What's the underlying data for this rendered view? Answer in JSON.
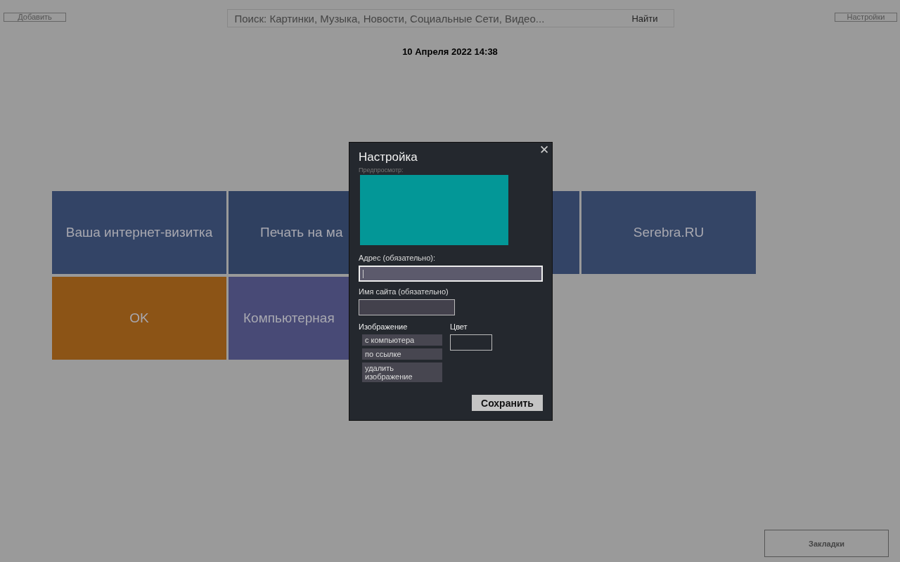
{
  "top_bar": {
    "add_button": "Добавить",
    "search": {
      "placeholder": "Поиск: Картинки, Музыка, Новости, Социальные Сети, Видео...",
      "button": "Найти"
    },
    "settings_button": "Настройки"
  },
  "datetime": "10 Апреля 2022 14:38",
  "tiles": [
    {
      "label": "Ваша интернет-визитка",
      "color": "#334466"
    },
    {
      "label": "Печать на ма",
      "color": "#2f4060"
    },
    {
      "color": "#334466"
    },
    {
      "label": "Serebra.RU",
      "color": "#344566"
    },
    {
      "label": "OK",
      "color": "#8c5416"
    },
    {
      "label": "Компьютерная",
      "color": "#484a76"
    }
  ],
  "dialog": {
    "title": "Настройка",
    "close": "✕",
    "preview_label": "Предпросмотр:",
    "address_label": "Адрес (обязательно):",
    "name_label": "Имя сайта (обязательно)",
    "image_label": "Изображение",
    "image_buttons": [
      "с компьютера",
      "по ссылке",
      "удалить изображение"
    ],
    "color_label": "Цвет",
    "save_button": "Сохранить"
  },
  "bookmarks_button": "Закладки"
}
